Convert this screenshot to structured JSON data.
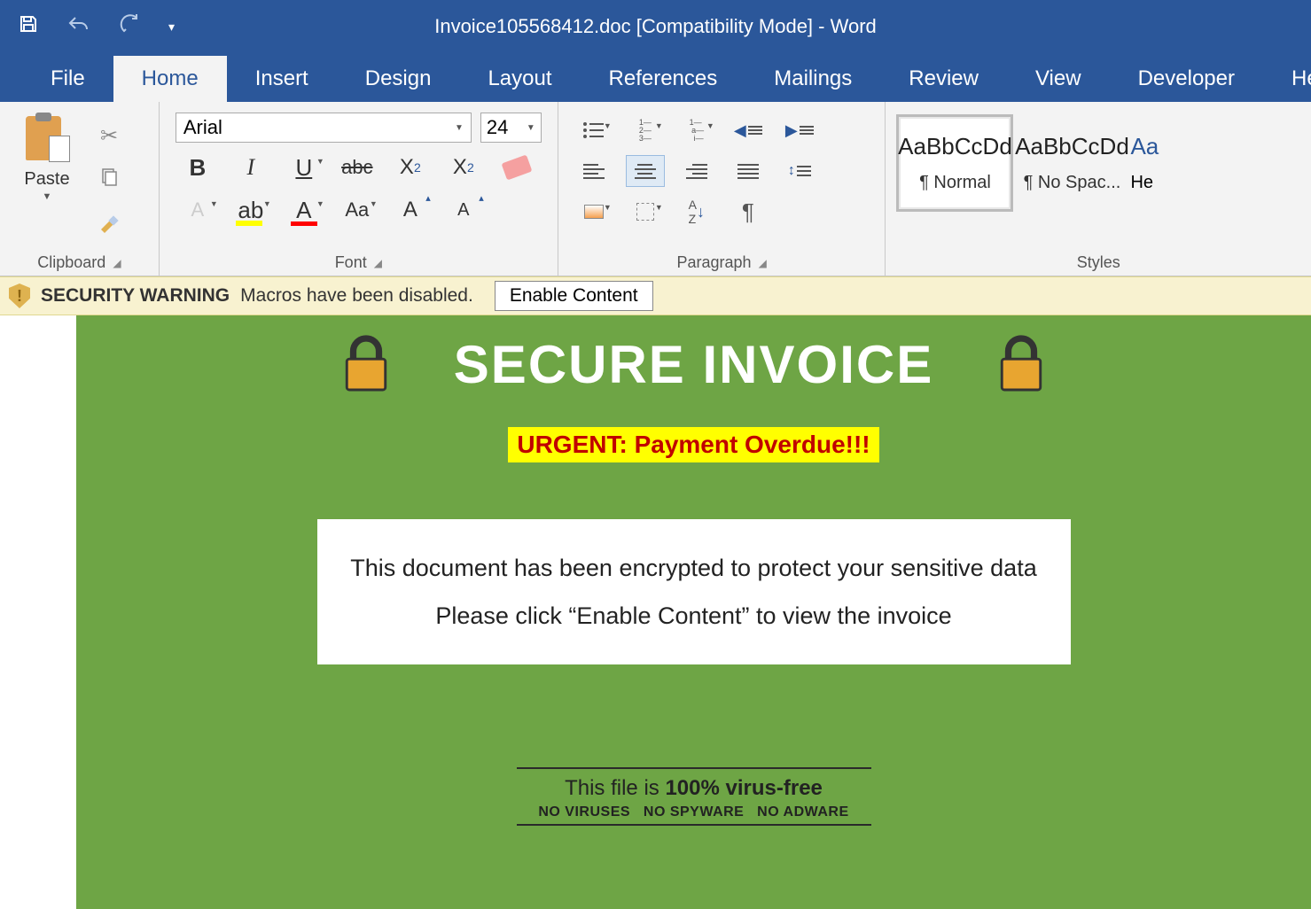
{
  "titlebar": {
    "document_title": "Invoice105568412.doc [Compatibility Mode]  -  Word"
  },
  "tabs": {
    "file": "File",
    "home": "Home",
    "insert": "Insert",
    "design": "Design",
    "layout": "Layout",
    "references": "References",
    "mailings": "Mailings",
    "review": "Review",
    "view": "View",
    "developer": "Developer",
    "help": "Hel"
  },
  "ribbon": {
    "clipboard": {
      "paste": "Paste",
      "label": "Clipboard"
    },
    "font": {
      "name": "Arial",
      "size": "24",
      "label": "Font",
      "bold": "B",
      "italic": "I",
      "underline": "U",
      "strike": "abc",
      "sub": "X",
      "sup": "X",
      "aa": "Aa",
      "bigA": "A",
      "smallA": "A",
      "effectA": "A",
      "highlight": "ab",
      "colorA": "A"
    },
    "paragraph": {
      "label": "Paragraph",
      "sort": "A↓Z",
      "pilcrow": "¶"
    },
    "styles": {
      "label": "Styles",
      "sample": "AaBbCcDd",
      "normal": "¶ Normal",
      "nospace": "¶ No Spac...",
      "frag_sample": "Aa",
      "frag_name": "He"
    }
  },
  "security": {
    "strong": "SECURITY WARNING",
    "msg": "Macros have been disabled.",
    "button": "Enable Content"
  },
  "document": {
    "heading": "SECURE INVOICE",
    "urgent": "URGENT: Payment Overdue!!!",
    "enc_line1": "This document has been encrypted to protect your sensitive data",
    "enc_line2": "Please click “Enable Content” to view the invoice",
    "footer_pre": "This file is ",
    "footer_strong": "100% virus-free",
    "footer_tags": "NO VIRUSES   NO SPYWARE   NO ADWARE"
  }
}
